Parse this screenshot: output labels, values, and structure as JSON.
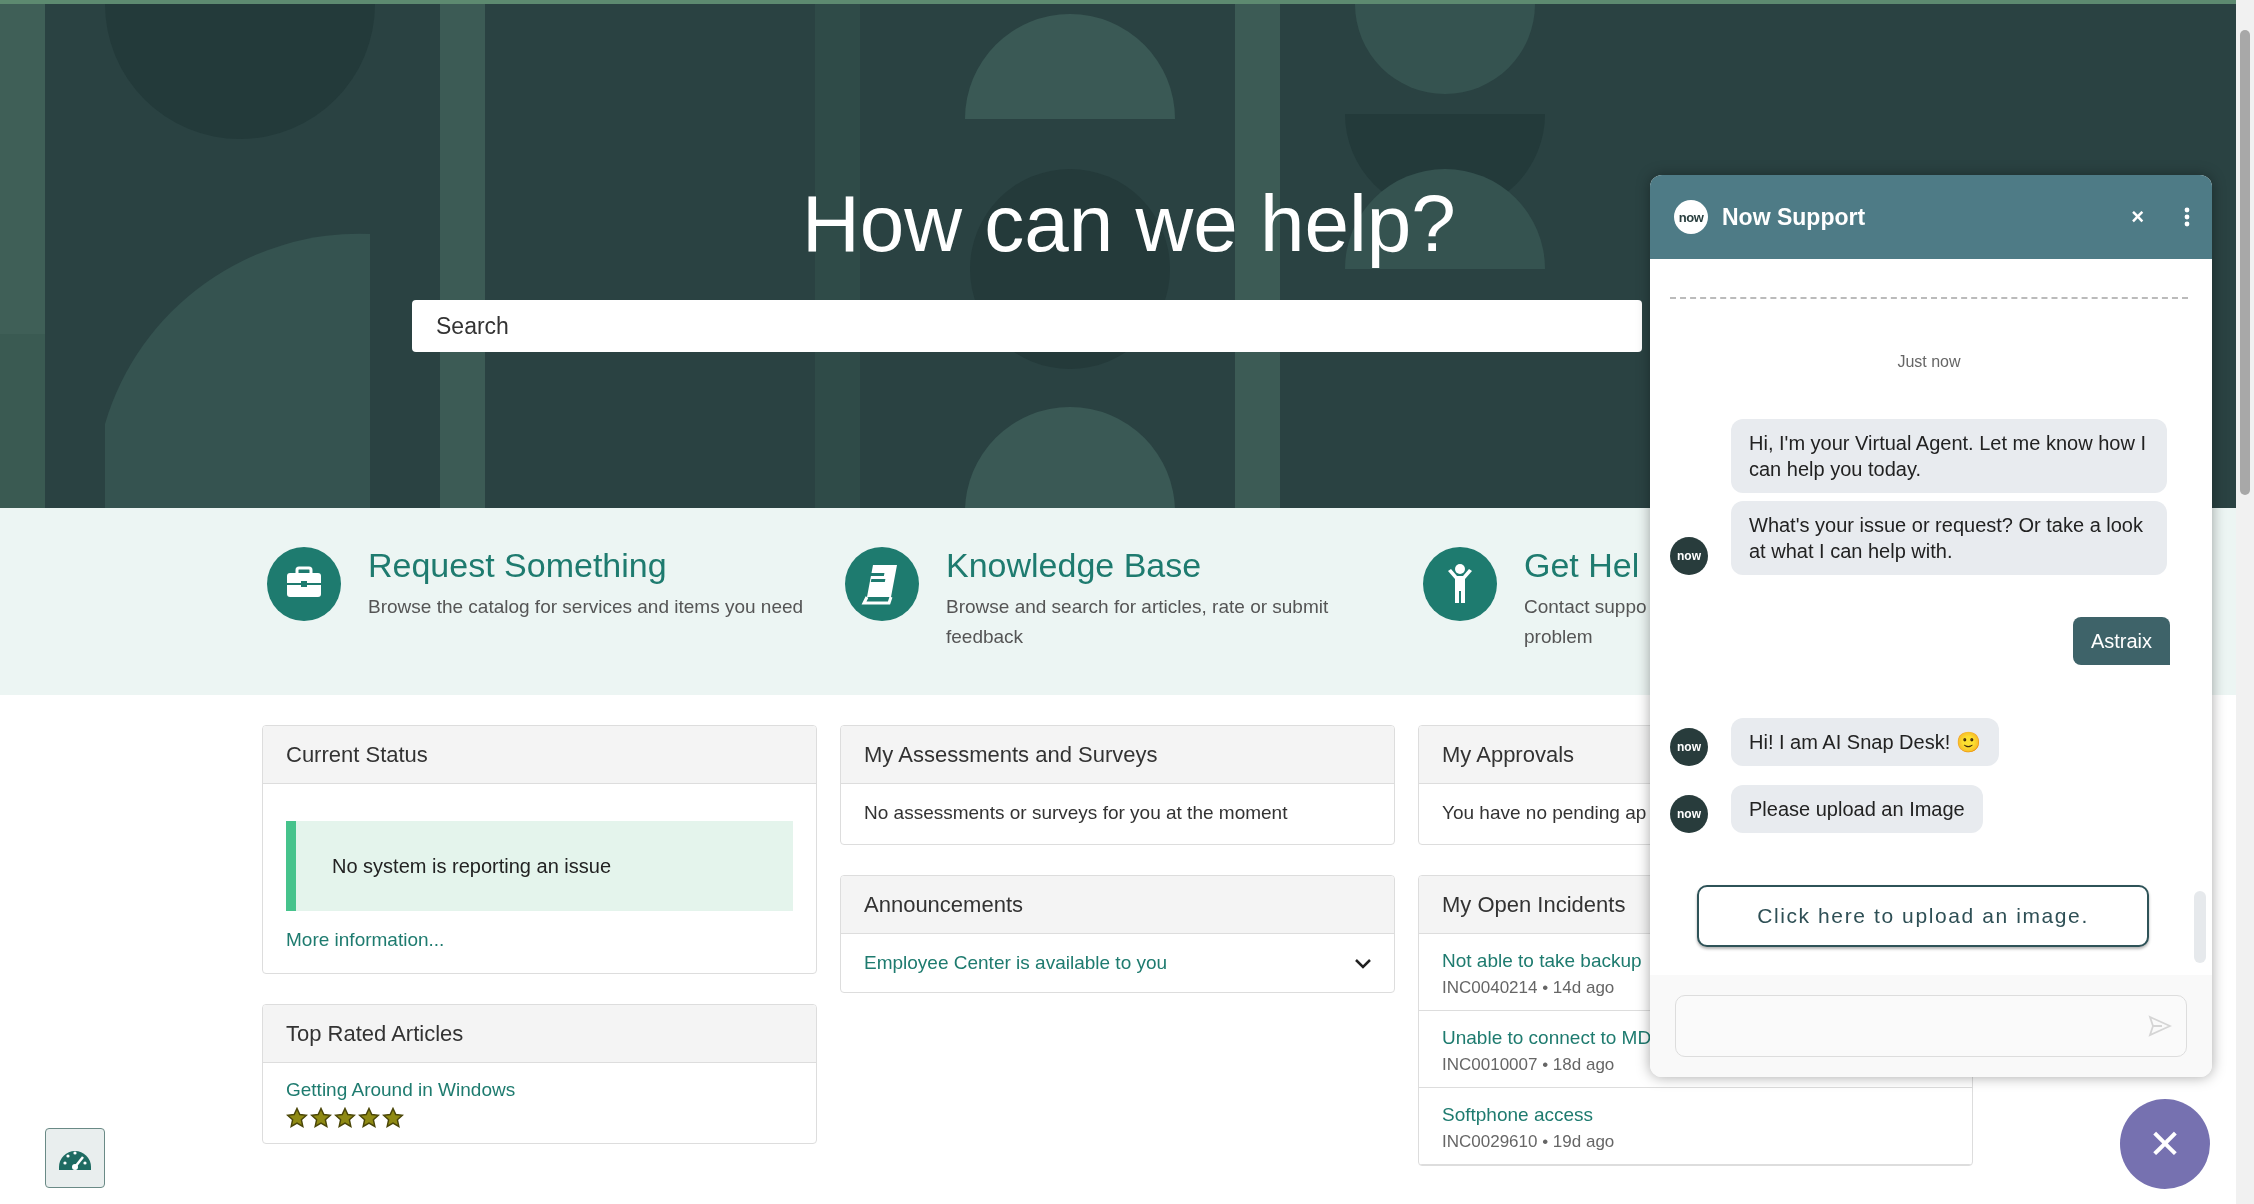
{
  "hero": {
    "title": "How can we help?",
    "search": {
      "placeholder": "Search"
    }
  },
  "tiles": [
    {
      "title": "Request Something",
      "description": "Browse the catalog for services and items you need"
    },
    {
      "title": "Knowledge Base",
      "description": "Browse and search for articles, rate or submit\nfeedback"
    },
    {
      "title": "Get Hel",
      "description": "Contact suppo\nproblem"
    }
  ],
  "columns": [
    [
      {
        "kind": "status",
        "title": "Current Status",
        "message": "No system is reporting an issue",
        "link": "More information..."
      },
      {
        "kind": "articles",
        "title": "Top Rated Articles",
        "articles": [
          {
            "title": "Getting Around in Windows",
            "stars": 5
          }
        ]
      }
    ],
    [
      {
        "kind": "text",
        "title": "My Assessments and Surveys",
        "text": "No assessments or surveys for you at the moment"
      },
      {
        "kind": "announcements",
        "title": "Announcements",
        "items": [
          {
            "title": "Employee Center is available to you",
            "expanded": false
          }
        ]
      }
    ],
    [
      {
        "kind": "text",
        "title": "My Approvals",
        "text": "You have no pending ap"
      },
      {
        "kind": "incidents",
        "title": "My Open Incidents",
        "items": [
          {
            "title": "Not able to take backup",
            "meta": "INC0040214 • 14d ago"
          },
          {
            "title": "Unable to connect to MD",
            "meta": "INC0010007 • 18d ago"
          },
          {
            "title": "Softphone access",
            "meta": "INC0029610 • 19d ago"
          }
        ]
      }
    ]
  ],
  "chat": {
    "logo": "now",
    "title": "Now Support",
    "close": "×",
    "timestamp": "Just now",
    "messages": [
      {
        "kind": "bot",
        "text": "Hi, I'm your Virtual Agent. Let me know how I can help you today."
      },
      {
        "kind": "bot",
        "text": "What's your issue or request? Or take a look at what I can help with.",
        "avatar_label": "now"
      },
      {
        "kind": "user",
        "text": "Astraix"
      },
      {
        "kind": "bot",
        "text": "Hi! I am AI Snap Desk! 🙂",
        "avatar_label": "now"
      },
      {
        "kind": "bot",
        "text": "Please upload an Image",
        "avatar_label": "now"
      }
    ],
    "upload_button": "Click here to upload an image."
  },
  "fab": {
    "label": "✕"
  }
}
